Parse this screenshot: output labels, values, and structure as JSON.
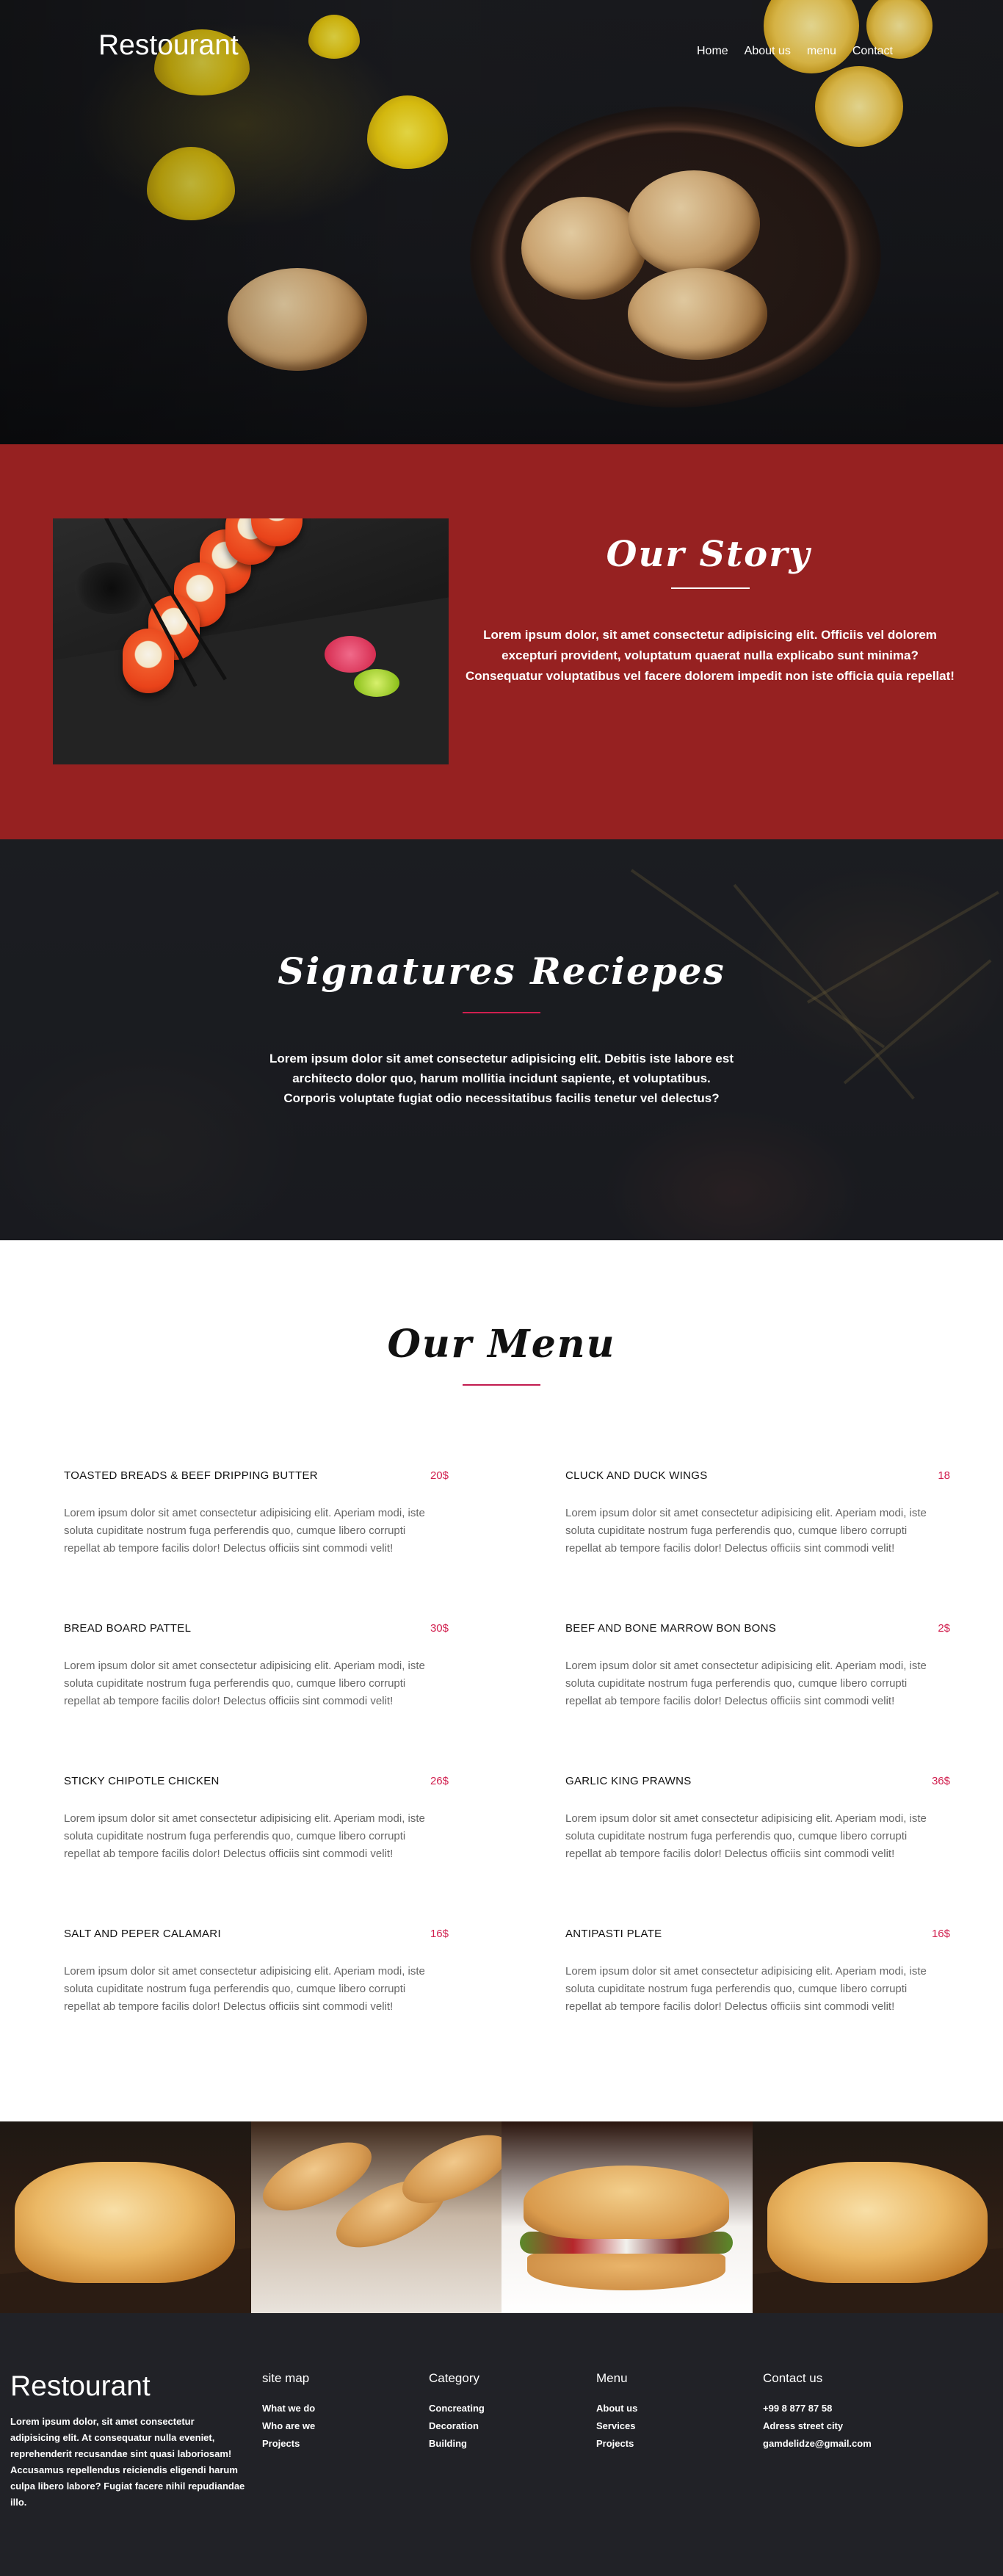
{
  "header": {
    "brand": "Restourant",
    "nav": [
      "Home",
      "About us",
      "menu",
      "Contact"
    ]
  },
  "story": {
    "title": "Our Story",
    "text": "Lorem ipsum dolor, sit amet consectetur adipisicing elit. Officiis vel dolorem excepturi provident, voluptatum quaerat nulla explicabo sunt minima? Consequatur voluptatibus vel facere dolorem impedit non iste officia quia repellat!"
  },
  "signatures": {
    "title": "Signatures Reciepes",
    "text": "Lorem ipsum dolor sit amet consectetur adipisicing elit. Debitis iste labore est architecto dolor quo, harum mollitia incidunt sapiente, et voluptatibus. Corporis voluptate fugiat odio necessitatibus facilis tenetur vel delectus?"
  },
  "menu": {
    "title": "Our Menu",
    "items": [
      {
        "name": "TOASTED BREADS & BEEF DRIPPING BUTTER",
        "price": "20$",
        "desc": "Lorem ipsum dolor sit amet consectetur adipisicing elit. Aperiam modi, iste soluta cupiditate nostrum fuga perferendis quo, cumque libero corrupti repellat ab tempore facilis dolor! Delectus officiis sint commodi velit!"
      },
      {
        "name": "CLUCK AND DUCK WINGS",
        "price": "18",
        "desc": "Lorem ipsum dolor sit amet consectetur adipisicing elit. Aperiam modi, iste soluta cupiditate nostrum fuga perferendis quo, cumque libero corrupti repellat ab tempore facilis dolor! Delectus officiis sint commodi velit!"
      },
      {
        "name": "BREAD BOARD PATTEL",
        "price": "30$",
        "desc": "Lorem ipsum dolor sit amet consectetur adipisicing elit. Aperiam modi, iste soluta cupiditate nostrum fuga perferendis quo, cumque libero corrupti repellat ab tempore facilis dolor! Delectus officiis sint commodi velit!"
      },
      {
        "name": "BEEF AND BONE MARROW BON BONS",
        "price": "2$",
        "desc": "Lorem ipsum dolor sit amet consectetur adipisicing elit. Aperiam modi, iste soluta cupiditate nostrum fuga perferendis quo, cumque libero corrupti repellat ab tempore facilis dolor! Delectus officiis sint commodi velit!"
      },
      {
        "name": "STICKY CHIPOTLE CHICKEN",
        "price": "26$",
        "desc": "Lorem ipsum dolor sit amet consectetur adipisicing elit. Aperiam modi, iste soluta cupiditate nostrum fuga perferendis quo, cumque libero corrupti repellat ab tempore facilis dolor! Delectus officiis sint commodi velit!"
      },
      {
        "name": "GARLIC KING PRAWNS",
        "price": "36$",
        "desc": "Lorem ipsum dolor sit amet consectetur adipisicing elit. Aperiam modi, iste soluta cupiditate nostrum fuga perferendis quo, cumque libero corrupti repellat ab tempore facilis dolor! Delectus officiis sint commodi velit!"
      },
      {
        "name": "SALT AND PEPER CALAMARI",
        "price": "16$",
        "desc": "Lorem ipsum dolor sit amet consectetur adipisicing elit. Aperiam modi, iste soluta cupiditate nostrum fuga perferendis quo, cumque libero corrupti repellat ab tempore facilis dolor! Delectus officiis sint commodi velit!"
      },
      {
        "name": "ANTIPASTI PLATE",
        "price": "16$",
        "desc": "Lorem ipsum dolor sit amet consectetur adipisicing elit. Aperiam modi, iste soluta cupiditate nostrum fuga perferendis quo, cumque libero corrupti repellat ab tempore facilis dolor! Delectus officiis sint commodi velit!"
      }
    ]
  },
  "footer": {
    "brand": "Restourant",
    "about": "Lorem ipsum dolor, sit amet consectetur adipisicing elit. At consequatur nulla eveniet, reprehenderit recusandae sint quasi laboriosam! Accusamus repellendus reiciendis eligendi harum culpa libero labore? Fugiat facere nihil repudiandae illo.",
    "columns": [
      {
        "title": "site map",
        "links": [
          "What we do",
          "Who are we",
          "Projects"
        ]
      },
      {
        "title": "Category",
        "links": [
          "Concreating",
          "Decoration",
          "Building"
        ]
      },
      {
        "title": "Menu",
        "links": [
          "About us",
          "Services",
          "Projects"
        ]
      },
      {
        "title": "Contact us",
        "links": [
          "+99 8 877 87 58",
          "Adress street city",
          "gamdelidze@gmail.com"
        ]
      }
    ]
  },
  "colors": {
    "story_bg": "#962121",
    "accent": "#d1204f",
    "dark_bg": "#212227"
  }
}
